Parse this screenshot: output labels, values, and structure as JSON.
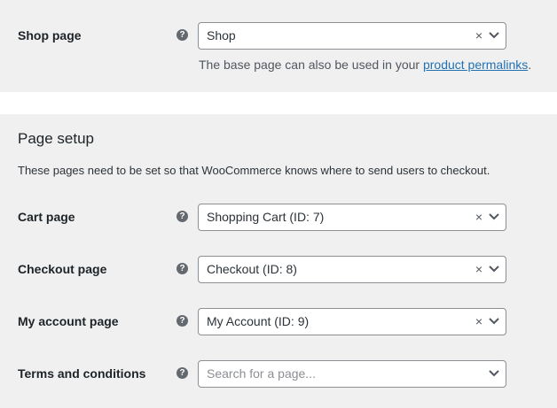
{
  "shop": {
    "label": "Shop page",
    "help": "?",
    "value": "Shop",
    "description_prefix": "The base page can also be used in your ",
    "description_link": "product permalinks",
    "description_suffix": "."
  },
  "setup": {
    "heading": "Page setup",
    "intro": "These pages need to be set so that WooCommerce knows where to send users to checkout.",
    "rows": [
      {
        "label": "Cart page",
        "help": "?",
        "value": "Shopping Cart (ID: 7)",
        "clear": "×"
      },
      {
        "label": "Checkout page",
        "help": "?",
        "value": "Checkout (ID: 8)",
        "clear": "×"
      },
      {
        "label": "My account page",
        "help": "?",
        "value": "My Account (ID: 9)",
        "clear": "×"
      },
      {
        "label": "Terms and conditions",
        "help": "?",
        "placeholder": "Search for a page..."
      }
    ]
  },
  "clear_symbol": "×"
}
